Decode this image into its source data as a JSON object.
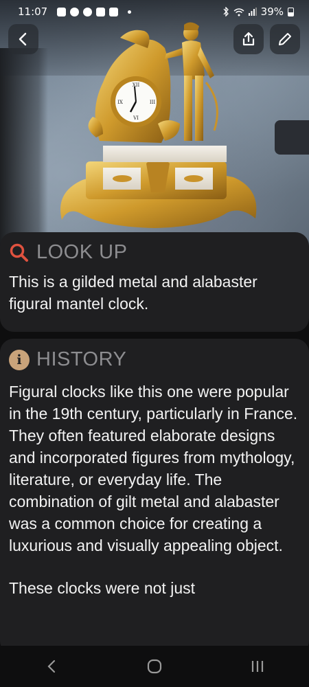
{
  "status_bar": {
    "time": "11:07",
    "battery": "39%"
  },
  "photo": {
    "icon": "gilded-figural-mantel-clock-photo"
  },
  "toolbar": {
    "back_icon": "chevron-left-icon",
    "share_icon": "share-icon",
    "edit_icon": "pencil-icon"
  },
  "lookup": {
    "title": "LOOK UP",
    "icon": "search-icon",
    "icon_color": "#e0523f",
    "body": "This is a gilded metal and alabaster figural mantel clock."
  },
  "history": {
    "title": "HISTORY",
    "icon": "info-icon",
    "icon_glyph": "i",
    "icon_color": "#c9a37a",
    "body": "Figural clocks like this one were popular in the 19th century, particularly in France. They often featured elaborate designs and incorporated figures from mythology, literature, or everyday life. The combination of gilt metal and alabaster was a common choice for creating a luxurious and visually appealing object.",
    "body_continued": "These clocks were not just"
  },
  "nav": {
    "back": "nav-back-icon",
    "home": "nav-home-icon",
    "recents": "nav-recents-icon"
  },
  "colors": {
    "card_bg": "#1f1f21",
    "page_bg": "#0e0e0f",
    "title_gray": "#8d8d90",
    "gold": "#d3a23a"
  }
}
